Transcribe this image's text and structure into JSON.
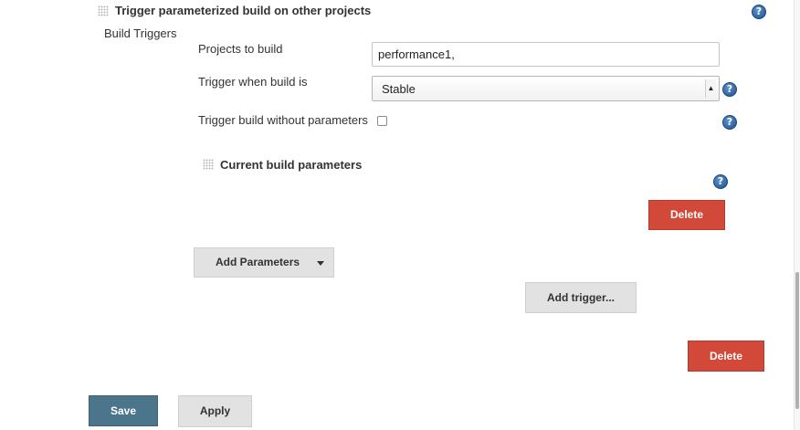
{
  "section": {
    "title": "Trigger parameterized build on other projects",
    "group_label": "Build Triggers"
  },
  "form": {
    "projects_label": "Projects to build",
    "projects_value": "performance1,",
    "trigger_when_label": "Trigger when build is",
    "trigger_when_selected": "Stable",
    "without_params_label": "Trigger build without parameters",
    "without_params_checked": false
  },
  "current_params": {
    "title": "Current build parameters",
    "delete_label": "Delete"
  },
  "buttons": {
    "add_parameters": "Add Parameters",
    "add_trigger": "Add trigger...",
    "delete_trigger": "Delete",
    "save": "Save",
    "apply": "Apply"
  },
  "help_icon_glyph": "?",
  "colors": {
    "delete": "#d24939",
    "save": "#4b758b",
    "help": "#2f65a3",
    "button_gray": "#e2e2e2"
  }
}
